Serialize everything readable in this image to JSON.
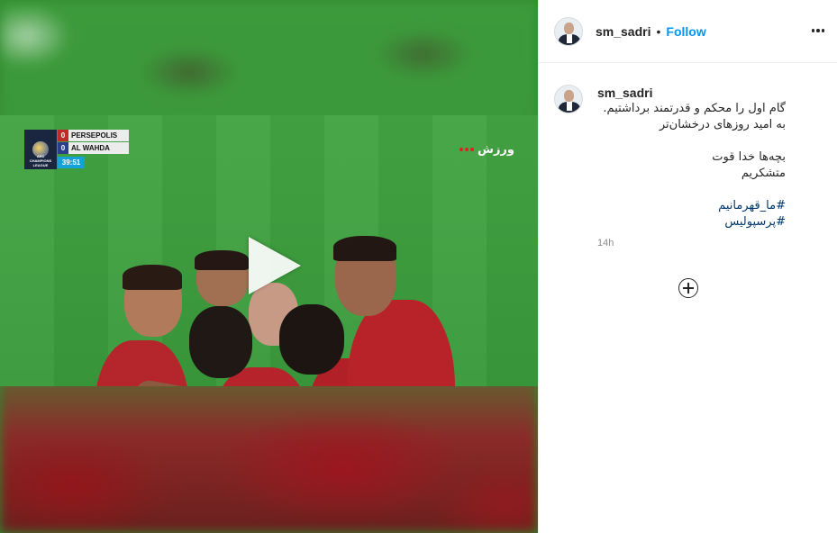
{
  "post": {
    "username": "sm_sadri",
    "separator": "•",
    "follow_label": "Follow",
    "more_icon": "more-horizontal-icon",
    "caption": {
      "username": "sm_sadri",
      "lines": [
        "گام اول را محکم و قدرتمند برداشتیم.",
        "به امید روزهای درخشان‌تر",
        "بچه‌ها خدا قوت",
        "متشکریم"
      ],
      "hashtags": [
        "#ما_قهرمانیم",
        "#پرسپولیس"
      ]
    },
    "timestamp": "14h",
    "add_comment_icon": "plus-circle-icon"
  },
  "video": {
    "play_icon": "play-icon",
    "scorebug": {
      "league_label": "AFC CHAMPIONS LEAGUE",
      "team1": "PERSEPOLIS",
      "score1": "0",
      "team2": "AL WAHDA",
      "score2": "0",
      "time": "39:51"
    },
    "channel_label": "ورزش"
  },
  "colors": {
    "follow": "#0095f6",
    "hashtag": "#00376b",
    "muted": "#8e8e8e",
    "pitch": "#3a9a3a",
    "kit": "#b5252c"
  }
}
